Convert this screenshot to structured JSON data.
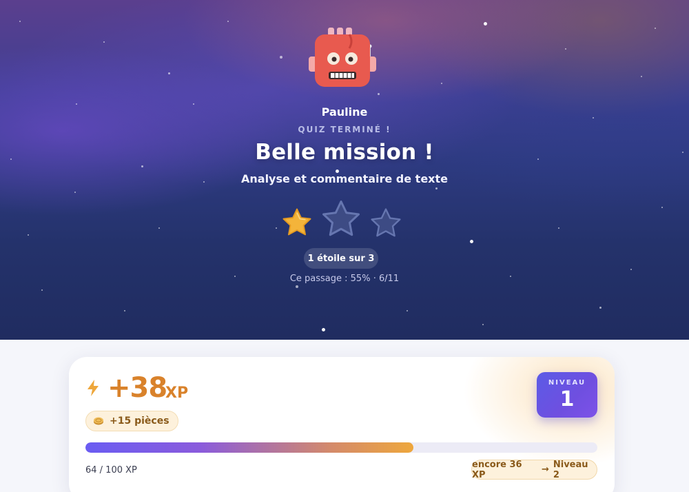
{
  "user": {
    "name": "Pauline",
    "avatar_icon": "robot-icon"
  },
  "result": {
    "status": "QUIZ TERMINÉ !",
    "title": "Belle mission !",
    "subtitle": "Analyse et commentaire de texte",
    "stars_earned": 1,
    "stars_total": 3,
    "stars_label": "1 étoile sur 3",
    "passage_label": "Ce passage : 55% · 6/11"
  },
  "xp": {
    "gained": "+38",
    "unit": "XP",
    "coins_label": "+15 pièces",
    "current": 64,
    "target": 100,
    "progress_label": "64 / 100 XP",
    "remaining_label": "encore 36 XP",
    "next_level_label": "Niveau 2"
  },
  "level": {
    "label": "NIVEAU",
    "number": "1"
  },
  "colors": {
    "accent_orange": "#d9822b",
    "star_gold": "#f4b43a",
    "star_empty": "#5a6aa8",
    "level_badge": "#5b5be6"
  }
}
